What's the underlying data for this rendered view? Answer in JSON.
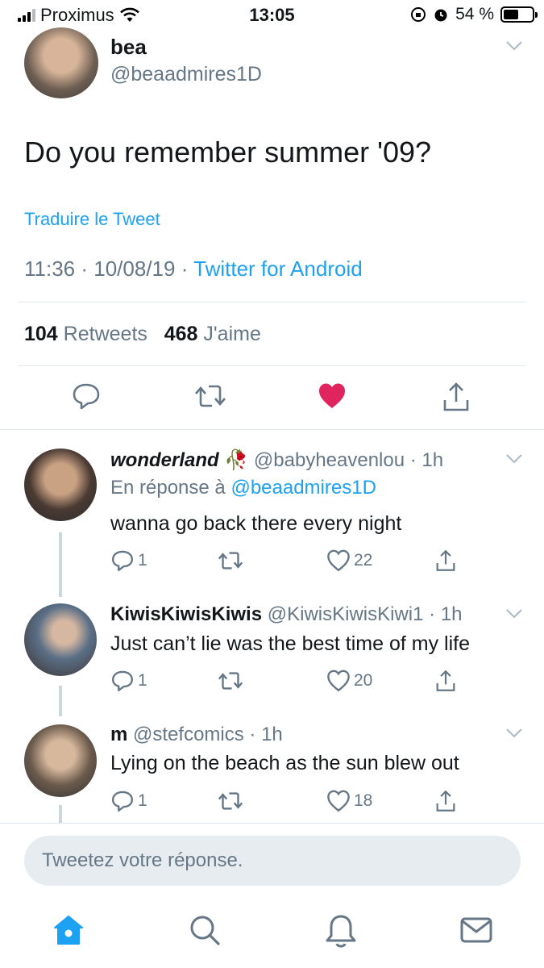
{
  "status_bar": {
    "carrier": "Proximus",
    "time": "13:05",
    "battery": "54 %",
    "battery_level": 0.54
  },
  "tweet": {
    "name": "bea",
    "handle": "@beaadmires1D",
    "text": "Do you remember summer '09?",
    "translate_label": "Traduire le Tweet",
    "time": "11:36",
    "date": "10/08/19",
    "source": "Twitter for Android",
    "retweets": "104",
    "retweets_label": "Retweets",
    "likes": "468",
    "likes_label": "J'aime"
  },
  "replies": [
    {
      "name": "wonderland",
      "handle": "@babyheavenlou",
      "time": "1h",
      "reply_to_label": "En réponse à",
      "reply_to": "@beaadmires1D",
      "text": "wanna go back there every night",
      "replies": "1",
      "retweets": "",
      "likes": "22"
    },
    {
      "name": "KiwisKiwisKiwis",
      "handle": "@KiwisKiwisKiwi1",
      "time": "1h",
      "text": "Just can’t lie was the best time of my life",
      "replies": "1",
      "retweets": "",
      "likes": "20"
    },
    {
      "name": "m",
      "handle": "@stefcomics",
      "time": "1h",
      "text": "Lying on the beach as the sun blew out",
      "replies": "1",
      "retweets": "",
      "likes": "18"
    }
  ],
  "compose": {
    "placeholder": "Tweetez votre réponse."
  },
  "nav": [
    "home-icon",
    "search-icon",
    "notifications-icon",
    "messages-icon"
  ],
  "colors": {
    "accent": "#1da1f2",
    "like": "#e0245e",
    "muted": "#657786"
  }
}
